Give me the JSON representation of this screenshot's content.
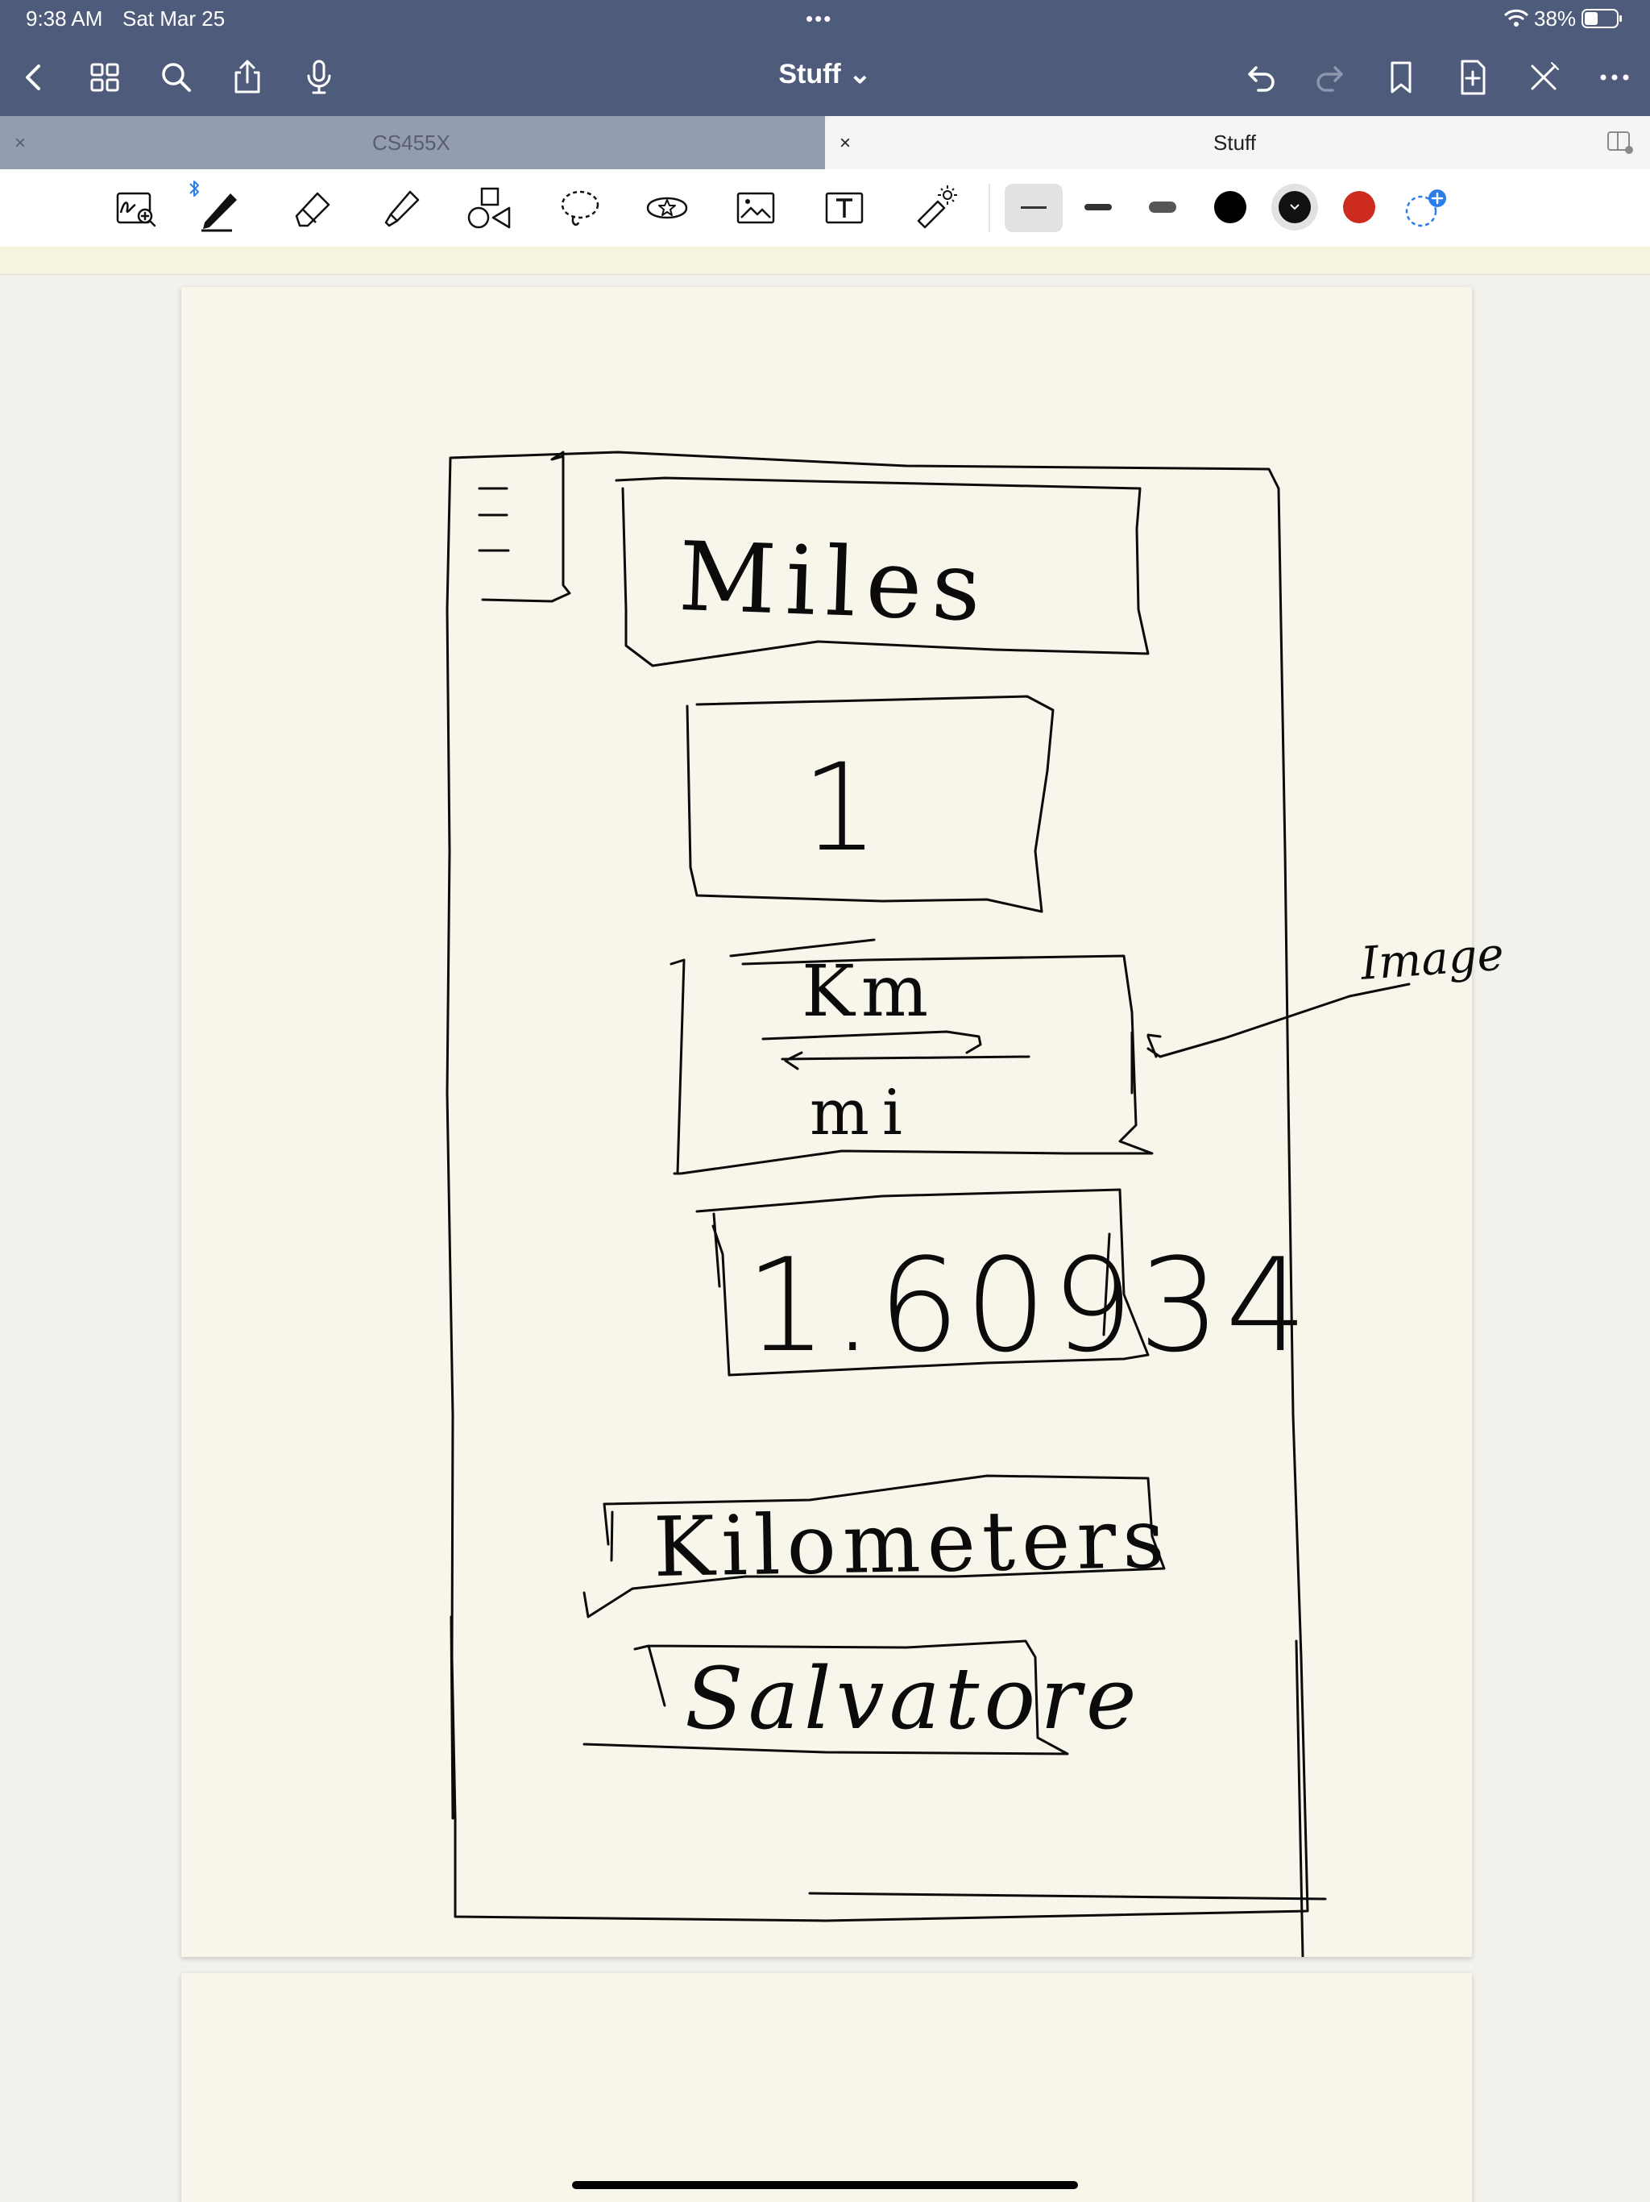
{
  "status_bar": {
    "time": "9:38 AM",
    "date": "Sat Mar 25",
    "battery": "38%"
  },
  "nav": {
    "title": "Stuff ⌄"
  },
  "tabs": [
    {
      "label": "CS455X",
      "close": "×",
      "active": false
    },
    {
      "label": "Stuff",
      "close": "×",
      "active": true
    }
  ],
  "toolbar": {
    "tools": [
      "zoom-writing-icon",
      "pen-icon",
      "eraser-icon",
      "highlighter-icon",
      "shapes-icon",
      "lasso-icon",
      "sticker-icon",
      "image-icon",
      "text-icon",
      "laser-pointer-icon"
    ],
    "colors": {
      "black": "#000000",
      "selected_black": "#111111",
      "red": "#cc2b1d",
      "add": "#2b7de9"
    },
    "bluetooth_color": "#2b7de9"
  },
  "sketch": {
    "field_label": "Miles",
    "input_value": "1",
    "image_top": "Km",
    "image_bottom": "mi",
    "image_annotation": "Image",
    "result_value": "1.60934",
    "unit_label": "Kilometers",
    "name_label": "Salvatore"
  },
  "colors": {
    "chrome": "#4f5b7a",
    "paper": "#f8f6ea",
    "ink": "#0b0b0b"
  }
}
